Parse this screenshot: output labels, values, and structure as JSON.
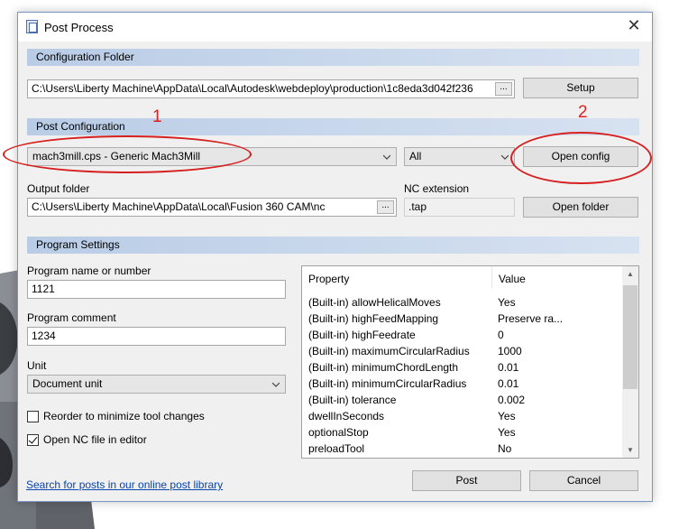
{
  "window": {
    "title": "Post Process"
  },
  "config_folder": {
    "header": "Configuration Folder",
    "path": "C:\\Users\\Liberty Machine\\AppData\\Local\\Autodesk\\webdeploy\\production\\1c8eda3d042f236",
    "browse_label": "...",
    "setup_label": "Setup"
  },
  "post_config": {
    "header": "Post Configuration",
    "selected": "mach3mill.cps - Generic Mach3Mill",
    "filter": "All",
    "open_config_label": "Open config",
    "output_folder_label": "Output folder",
    "output_folder": "C:\\Users\\Liberty Machine\\AppData\\Local\\Fusion 360 CAM\\nc",
    "browse_label": "...",
    "nc_ext_label": "NC extension",
    "nc_ext": ".tap",
    "open_folder_label": "Open folder"
  },
  "program": {
    "header": "Program Settings",
    "name_label": "Program name or number",
    "name": "1121",
    "comment_label": "Program comment",
    "comment": "1234",
    "unit_label": "Unit",
    "unit": "Document unit",
    "reorder_label": "Reorder to minimize tool changes",
    "reorder_checked": false,
    "open_nc_label": "Open NC file in editor",
    "open_nc_checked": true
  },
  "properties": {
    "col_property": "Property",
    "col_value": "Value",
    "rows": [
      {
        "property": "(Built-in) allowHelicalMoves",
        "value": "Yes"
      },
      {
        "property": "(Built-in) highFeedMapping",
        "value": "Preserve ra..."
      },
      {
        "property": "(Built-in) highFeedrate",
        "value": "0"
      },
      {
        "property": "(Built-in) maximumCircularRadius",
        "value": "1000"
      },
      {
        "property": "(Built-in) minimumChordLength",
        "value": "0.01"
      },
      {
        "property": "(Built-in) minimumCircularRadius",
        "value": "0.01"
      },
      {
        "property": "(Built-in) tolerance",
        "value": "0.002"
      },
      {
        "property": "dwellInSeconds",
        "value": "Yes"
      },
      {
        "property": "optionalStop",
        "value": "Yes"
      },
      {
        "property": "preloadTool",
        "value": "No"
      }
    ]
  },
  "footer": {
    "search_link": "Search for posts in our online post library",
    "post_label": "Post",
    "cancel_label": "Cancel"
  },
  "annotations": {
    "one": "1",
    "two": "2",
    "color": "#e02020"
  },
  "colors": {
    "section_bar": "#b9cce6",
    "link": "#0645ad"
  }
}
